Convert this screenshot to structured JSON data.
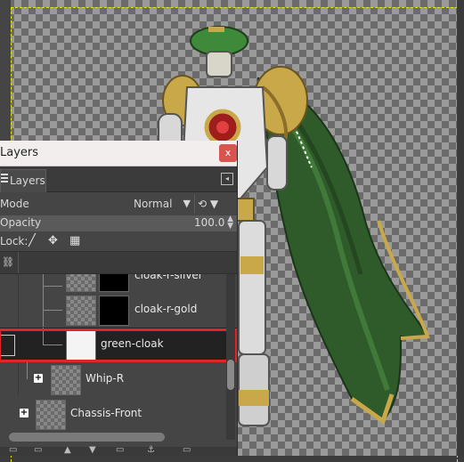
{
  "dialog": {
    "title": "Layers",
    "close_label": "x",
    "tab_label": "Layers",
    "mode_label": "Mode",
    "mode_value": "Normal",
    "opacity_label": "Opacity",
    "opacity_value": "100.0",
    "lock_label": "Lock:"
  },
  "layers": [
    {
      "name": "cloak-r-silver"
    },
    {
      "name": "cloak-r-gold"
    },
    {
      "name": "green-cloak",
      "selected": true
    },
    {
      "name": "Whip-R"
    },
    {
      "name": "Chassis-Front"
    }
  ],
  "colors": {
    "selection": "#e0262b",
    "canvas_border": "#e4e400",
    "cloak_green": "#2f5a2a",
    "gold": "#c9a84a"
  },
  "icons": [
    "close-icon",
    "hamburger-icon",
    "tab-config-icon",
    "chevron-down-icon",
    "mode-switch-icon",
    "brush-lock-icon",
    "move-lock-icon",
    "alpha-lock-icon",
    "chain-icon",
    "expand-icon"
  ]
}
